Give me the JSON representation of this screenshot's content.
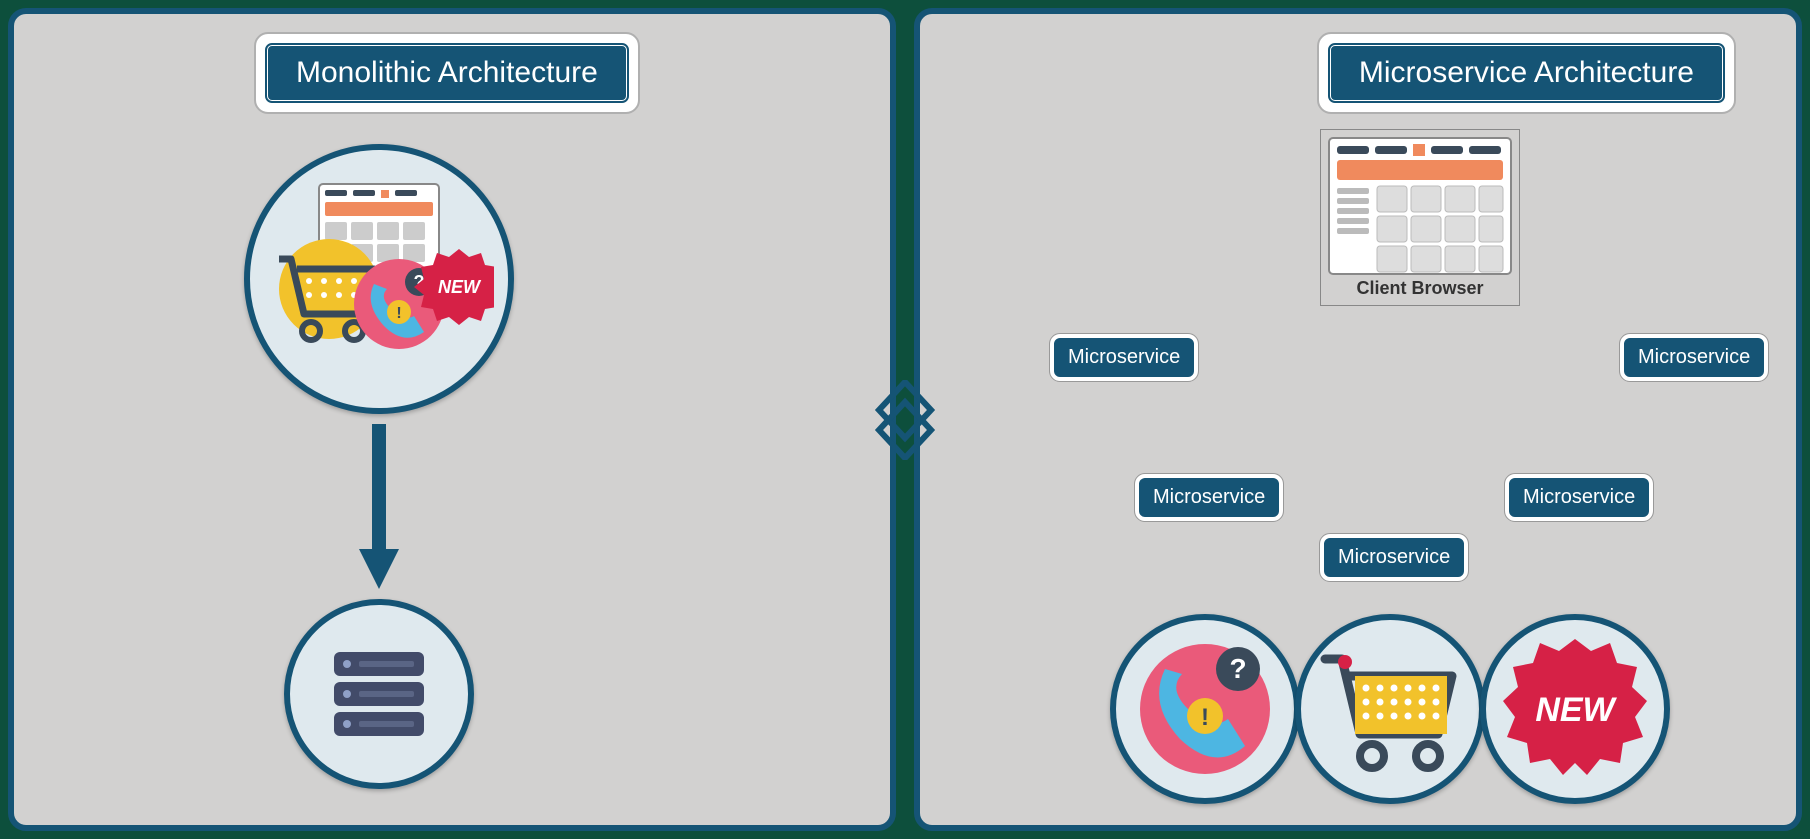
{
  "left": {
    "title": "Monolithic Architecture"
  },
  "right": {
    "title": "Microservice Architecture",
    "clientBrowser": "Client Browser",
    "services": {
      "a": "Microservice",
      "b": "Microservice",
      "c": "Microservice",
      "d": "Microservice",
      "e": "Microservice"
    },
    "newBadge": "NEW"
  },
  "colors": {
    "primary": "#155475",
    "panel": "#d2d1d0",
    "accentOrange": "#f08a5d",
    "red": "#d62146",
    "yellow": "#f2c22b",
    "slate": "#424b69"
  }
}
